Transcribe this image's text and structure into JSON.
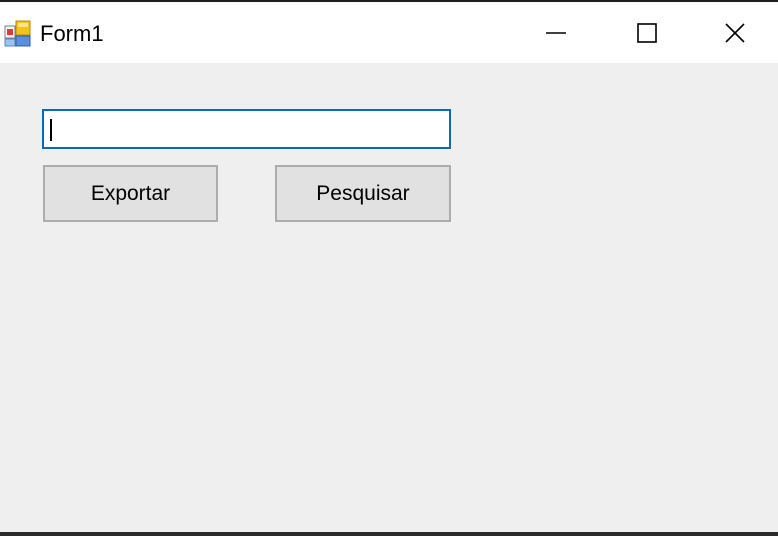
{
  "window": {
    "title": "Form1",
    "icon": "winforms-app-icon"
  },
  "caption_buttons": {
    "minimize": "minimize-icon",
    "maximize": "maximize-icon",
    "close": "close-icon"
  },
  "form": {
    "search_input": {
      "value": "",
      "placeholder": ""
    },
    "export_label": "Exportar",
    "search_label": "Pesquisar"
  },
  "colors": {
    "titlebar": "#ffffff",
    "client_area": "#efefef",
    "input_focus_border": "#0a6ab3",
    "button_face": "#e1e1e1",
    "button_border": "#adadad"
  }
}
